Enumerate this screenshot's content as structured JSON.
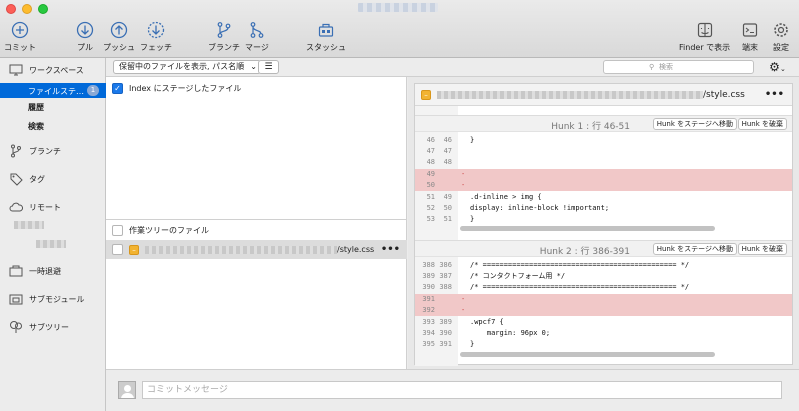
{
  "toolbar": {
    "buttons": [
      {
        "label": "コミット",
        "icon": "plus-circle-icon"
      },
      {
        "label": "プル",
        "icon": "arrow-down-circle-icon"
      },
      {
        "label": "プッシュ",
        "icon": "arrow-up-circle-icon"
      },
      {
        "label": "フェッチ",
        "icon": "download-dashed-circle-icon"
      },
      {
        "label": "ブランチ",
        "icon": "branch-icon"
      },
      {
        "label": "マージ",
        "icon": "merge-icon"
      },
      {
        "label": "スタッシュ",
        "icon": "stash-icon"
      },
      {
        "label": "Finder で表示",
        "icon": "finder-icon"
      },
      {
        "label": "端末",
        "icon": "terminal-icon"
      },
      {
        "label": "設定",
        "icon": "gear-icon"
      }
    ]
  },
  "sidebar": {
    "workspace": "ワークスペース",
    "file_status": "ファイルステ…",
    "file_status_count": "1",
    "history": "履歴",
    "search": "検索",
    "branches": "ブランチ",
    "tags": "タグ",
    "remotes": "リモート",
    "stashes": "一時退避",
    "submodules": "サブモジュール",
    "subtrees": "サブツリー"
  },
  "filterbar": {
    "dropdown": "保留中のファイルを表示, パス名順",
    "search_placeholder": "検索"
  },
  "staged": {
    "header": "Index にステージしたファイル"
  },
  "unstaged": {
    "header": "作業ツリーのファイル",
    "file_name": "/style.css"
  },
  "diff": {
    "file_name": "/style.css",
    "hunks": [
      {
        "title": "Hunk 1 : 行 46-51",
        "stage_label": "Hunk をステージへ移動",
        "discard_label": "Hunk を破棄",
        "lines": [
          {
            "old": "46",
            "new": "46",
            "type": "ctx",
            "text": "}"
          },
          {
            "old": "47",
            "new": "47",
            "type": "ctx",
            "text": ""
          },
          {
            "old": "48",
            "new": "48",
            "type": "ctx",
            "text": ""
          },
          {
            "old": "49",
            "new": "",
            "type": "del",
            "text": "-"
          },
          {
            "old": "50",
            "new": "",
            "type": "del",
            "text": "-"
          },
          {
            "old": "51",
            "new": "49",
            "type": "ctx",
            "text": ".d-inline > img {"
          },
          {
            "old": "52",
            "new": "50",
            "type": "ctx",
            "text": "display: inline-block !important;"
          },
          {
            "old": "53",
            "new": "51",
            "type": "ctx",
            "text": "}"
          }
        ]
      },
      {
        "title": "Hunk 2 : 行 386-391",
        "stage_label": "Hunk をステージへ移動",
        "discard_label": "Hunk を破棄",
        "lines": [
          {
            "old": "388",
            "new": "386",
            "type": "ctx",
            "text": "/* ============================================== */"
          },
          {
            "old": "389",
            "new": "387",
            "type": "ctx",
            "text": "/* コンタクトフォーム用 */"
          },
          {
            "old": "390",
            "new": "388",
            "type": "ctx",
            "text": "/* ============================================== */"
          },
          {
            "old": "391",
            "new": "",
            "type": "del",
            "text": "-"
          },
          {
            "old": "392",
            "new": "",
            "type": "del",
            "text": "-"
          },
          {
            "old": "393",
            "new": "389",
            "type": "ctx",
            "text": ".wpcf7 {"
          },
          {
            "old": "394",
            "new": "390",
            "type": "ctx",
            "text": "    margin: 96px 0;"
          },
          {
            "old": "395",
            "new": "391",
            "type": "ctx",
            "text": "}"
          }
        ]
      }
    ]
  },
  "commit": {
    "placeholder": "コミットメッセージ"
  }
}
